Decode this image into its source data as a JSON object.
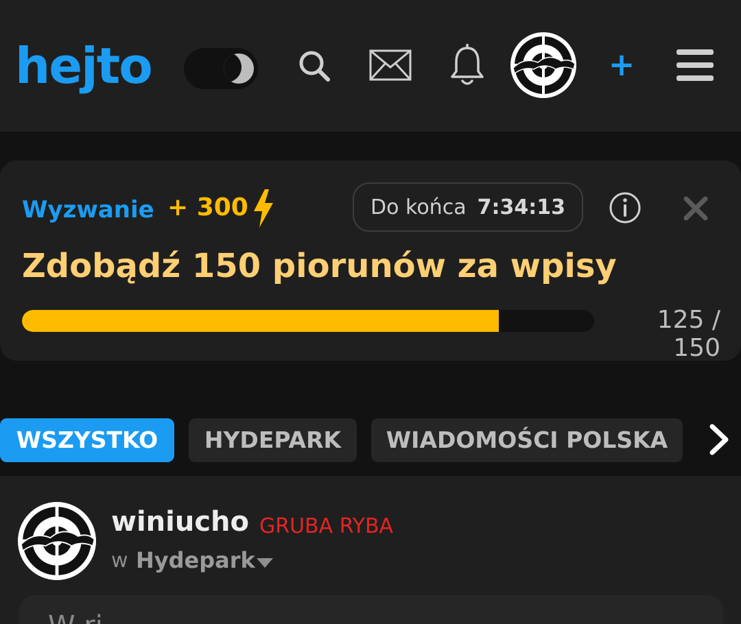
{
  "header": {
    "logo": "hejto",
    "icons": [
      "moon-icon",
      "search-icon",
      "mail-icon",
      "bell-icon",
      "plus-icon",
      "menu-icon"
    ],
    "add_label": "+"
  },
  "challenge": {
    "label": "Wyzwanie",
    "points": "+ 300",
    "timer_label": "Do końca",
    "timer_value": "7:34:13",
    "title": "Zdobądź 150 piorunów za wpisy",
    "progress_text": "125 / 150",
    "progress": {
      "current": 125,
      "total": 150
    }
  },
  "tabs": [
    {
      "label": "WSZYSTKO",
      "active": true
    },
    {
      "label": "HYDEPARK",
      "active": false
    },
    {
      "label": "WIADOMOŚCI POLSKA",
      "active": false
    }
  ],
  "post": {
    "username": "winiucho",
    "rank": "GRUBA RYBA",
    "in_label": "w",
    "community": "Hydepark",
    "content_preview": "W ri       "
  },
  "colors": {
    "accent": "#1b9cf2",
    "bolt": "#ffbb00",
    "title": "#ffcf73",
    "rank": "#e52424",
    "background": "#121212",
    "surface": "#1f1f1f"
  }
}
